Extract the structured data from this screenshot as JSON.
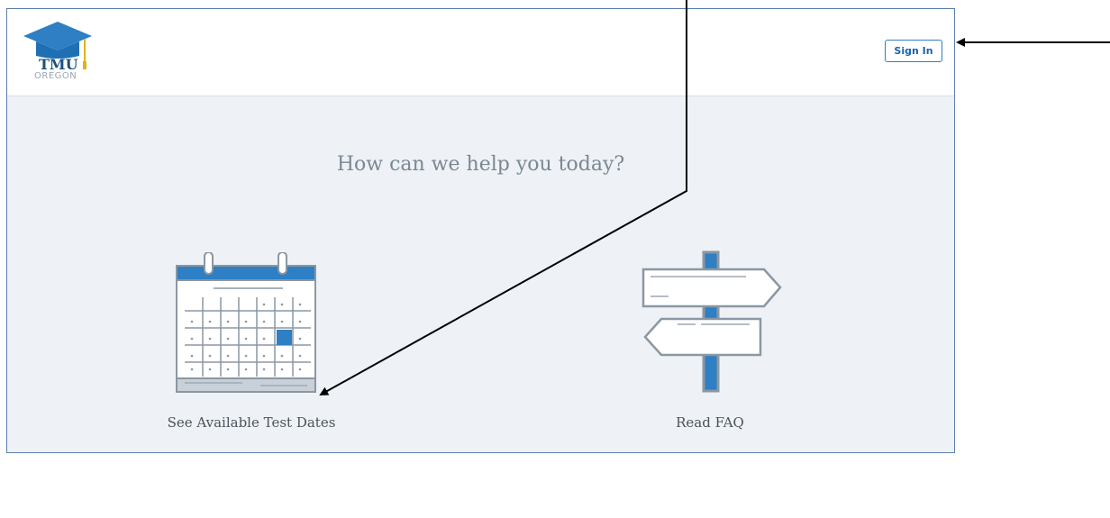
{
  "header": {
    "logo_text": "TMU",
    "logo_subtitle": "OREGON",
    "sign_in_label": "Sign In"
  },
  "main": {
    "headline": "How can we help you today?",
    "options": [
      {
        "label": "See Available Test Dates",
        "icon": "calendar-icon"
      },
      {
        "label": "Read FAQ",
        "icon": "signpost-icon"
      }
    ]
  },
  "colors": {
    "brand_blue": "#2e7fc3",
    "frame_border": "#5b7fae",
    "background": "#eef2f6",
    "icon_gray": "#8b97a3"
  }
}
